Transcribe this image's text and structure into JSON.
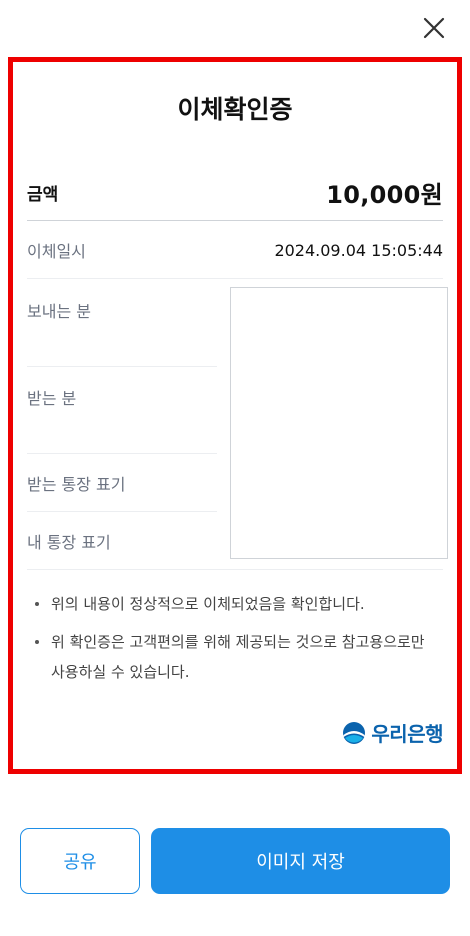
{
  "receipt": {
    "title": "이체확인증",
    "amount_label": "금액",
    "amount_value": "10,000원",
    "datetime_label": "이체일시",
    "datetime_value": "2024.09.04 15:05:44",
    "sender_label": "보내는 분",
    "receiver_label": "받는 분",
    "receiver_memo_label": "받는 통장 표기",
    "my_memo_label": "내 통장 표기",
    "notes": [
      "위의 내용이 정상적으로 이체되었음을 확인합니다.",
      "위 확인증은 고객편의를 위해 제공되는 것으로 참고용으로만 사용하실 수 있습니다."
    ],
    "bank_name": "우리은행"
  },
  "actions": {
    "share_label": "공유",
    "save_image_label": "이미지 저장"
  },
  "icons": {
    "close": "close-icon",
    "bank_logo": "woori-bank-logo-icon"
  },
  "colors": {
    "accent": "#1e8ee6",
    "highlight_frame": "#ee0000",
    "bank_brand": "#0b63ad"
  }
}
